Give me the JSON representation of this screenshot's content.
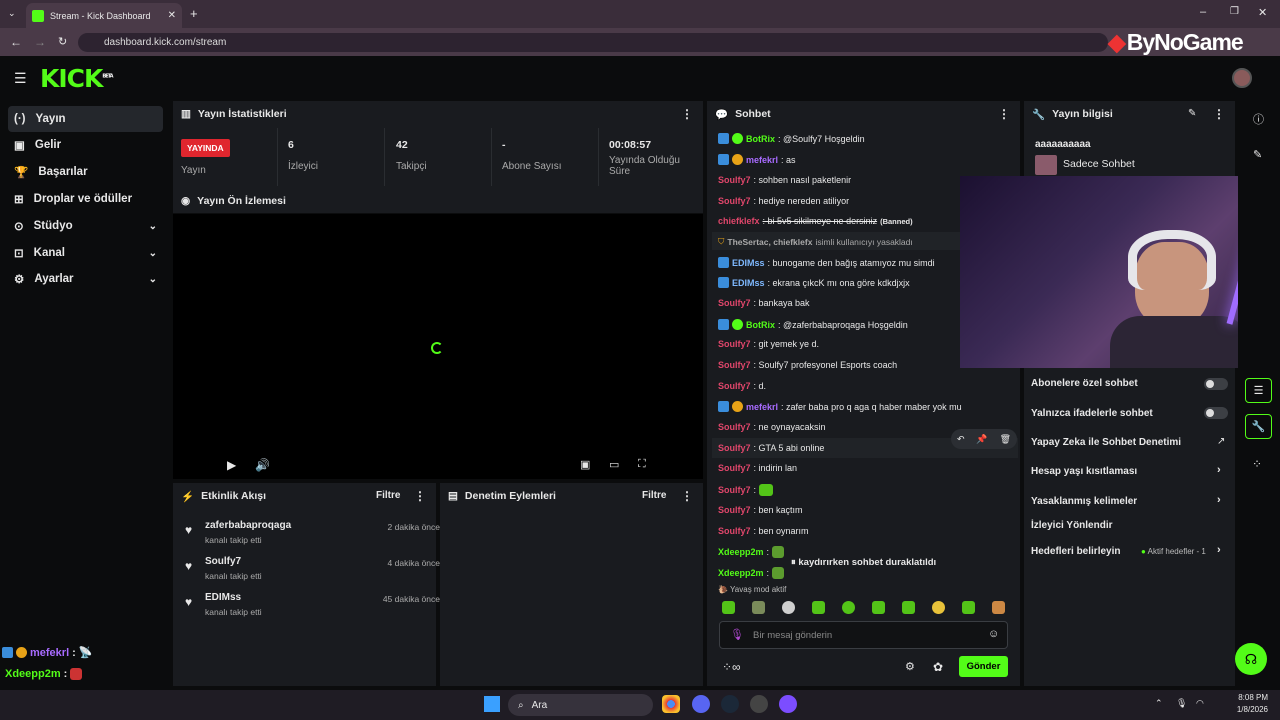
{
  "browser": {
    "tab_title": "Stream - Kick Dashboard",
    "url": "dashboard.kick.com/stream",
    "watermark": "ByNoGame"
  },
  "kick": {
    "logo": "KICK",
    "beta": "BETA"
  },
  "sidebar": {
    "items": [
      {
        "label": "Yayın",
        "icon": "broadcast-icon"
      },
      {
        "label": "Gelir",
        "icon": "money-icon"
      },
      {
        "label": "Başarılar",
        "icon": "trophy-icon"
      },
      {
        "label": "Droplar ve ödüller",
        "icon": "gift-icon"
      },
      {
        "label": "Stüdyo",
        "icon": "studio-icon"
      },
      {
        "label": "Kanal",
        "icon": "channel-icon"
      },
      {
        "label": "Ayarlar",
        "icon": "gear-icon"
      }
    ]
  },
  "stats": {
    "title": "Yayın İstatistikleri",
    "live_badge": "YAYINDA",
    "live_label": "Yayın",
    "viewers": {
      "value": "6",
      "label": "İzleyici"
    },
    "followers": {
      "value": "42",
      "label": "Takipçi"
    },
    "subs": {
      "value": "-",
      "label": "Abone Sayısı"
    },
    "uptime": {
      "value": "00:08:57",
      "label": "Yayında Olduğu Süre"
    }
  },
  "preview": {
    "title": "Yayın Ön İzlemesi"
  },
  "activity": {
    "title": "Etkinlik Akışı",
    "filter": "Filtre",
    "items": [
      {
        "name": "zaferbabaproqaga",
        "sub": "kanalı takip etti",
        "time": "2 dakika önce"
      },
      {
        "name": "Soulfy7",
        "sub": "kanalı takip etti",
        "time": "4 dakika önce"
      },
      {
        "name": "EDIMss",
        "sub": "kanalı takip etti",
        "time": "45 dakika önce"
      }
    ]
  },
  "moderation": {
    "title": "Denetim Eylemleri",
    "filter": "Filtre"
  },
  "chat": {
    "title": "Sohbet",
    "messages": [
      {
        "user": "BotRix",
        "text": ": @Soulfy7 Hoşgeldin"
      },
      {
        "user": "mefekrl",
        "text": ": as"
      },
      {
        "user": "Soulfy7",
        "text": ": sohben nasıl paketlenir"
      },
      {
        "user": "Soulfy7",
        "text": ": hediye nereden atiliyor"
      },
      {
        "user": "chiefklefx",
        "text": ": bi 5v5 sikilmeye ne dersiniz",
        "extra": "(Banned)"
      },
      {
        "user": "TheSertac, chiefklefx",
        "text": "isimli kullanıcıyı yasakladı"
      },
      {
        "user": "EDIMss",
        "text": ": bunogame den bağış atamıyoz mu simdi"
      },
      {
        "user": "EDIMss",
        "text": ": ekrana çıkcK mı ona göre kdkdjxjx"
      },
      {
        "user": "Soulfy7",
        "text": ": bankaya bak"
      },
      {
        "user": "BotRix",
        "text": ": @zaferbabaproqaga Hoşgeldin"
      },
      {
        "user": "Soulfy7",
        "text": ": git yemek ye d."
      },
      {
        "user": "Soulfy7",
        "text": ": Soulfy7 profesyonel Esports coach"
      },
      {
        "user": "Soulfy7",
        "text": ": d."
      },
      {
        "user": "mefekrl",
        "text": ": zafer baba pro q aga q haber maber yok mu"
      },
      {
        "user": "Soulfy7",
        "text": ": ne oynayacaksin"
      },
      {
        "user": "Soulfy7",
        "text": ": GTA 5 abi online"
      },
      {
        "user": "Soulfy7",
        "text": ": indirin lan"
      },
      {
        "user": "Soulfy7",
        "text": ":"
      },
      {
        "user": "Soulfy7",
        "text": ": ben kaçtım"
      },
      {
        "user": "Soulfy7",
        "text": ": ben oynarım"
      },
      {
        "user": "Xdeepp2m",
        "text": ":"
      },
      {
        "user": "Xdeepp2m",
        "text": ":"
      }
    ],
    "paused": "kaydırırken sohbet duraklatıldı",
    "slow_mode": "Yavaş mod aktif",
    "input_placeholder": "Bir mesaj gönderin",
    "send": "Gönder"
  },
  "stream_info": {
    "title": "Yayın bilgisi",
    "stream_title": "aaaaaaaaaa",
    "category": "Sadece Sohbet",
    "rows": [
      {
        "label": "Abonelere özel sohbet"
      },
      {
        "label": "Yalnızca ifadelerle sohbet"
      },
      {
        "label": "Yapay Zeka ile Sohbet Denetimi"
      },
      {
        "label": "Hesap yaşı kısıtlaması"
      },
      {
        "label": "Yasaklanmış kelimeler"
      },
      {
        "label": "İzleyici Yönlendir"
      },
      {
        "label": "Hedefleri belirleyin",
        "status": "Aktif hedefler - 1"
      }
    ]
  },
  "overlay_chat": [
    {
      "user": "mefekrl",
      "text": ":"
    },
    {
      "user": "Xdeepp2m",
      "text": ":"
    }
  ],
  "taskbar": {
    "search": "Ara",
    "time": "8:08 PM",
    "date": "1/8/2026"
  }
}
